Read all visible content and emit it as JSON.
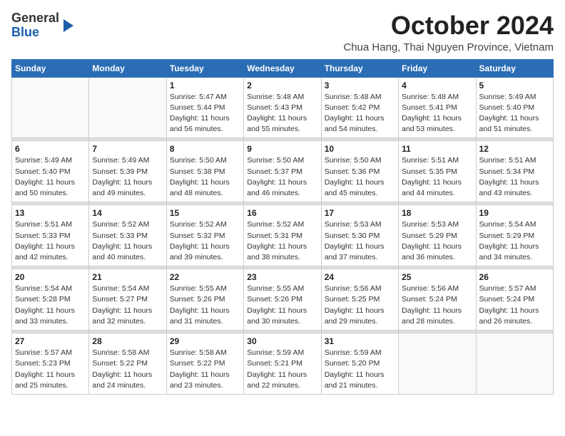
{
  "header": {
    "logo_general": "General",
    "logo_blue": "Blue",
    "month_title": "October 2024",
    "location": "Chua Hang, Thai Nguyen Province, Vietnam"
  },
  "weekdays": [
    "Sunday",
    "Monday",
    "Tuesday",
    "Wednesday",
    "Thursday",
    "Friday",
    "Saturday"
  ],
  "weeks": [
    [
      {
        "day": "",
        "info": ""
      },
      {
        "day": "",
        "info": ""
      },
      {
        "day": "1",
        "info": "Sunrise: 5:47 AM\nSunset: 5:44 PM\nDaylight: 11 hours and 56 minutes."
      },
      {
        "day": "2",
        "info": "Sunrise: 5:48 AM\nSunset: 5:43 PM\nDaylight: 11 hours and 55 minutes."
      },
      {
        "day": "3",
        "info": "Sunrise: 5:48 AM\nSunset: 5:42 PM\nDaylight: 11 hours and 54 minutes."
      },
      {
        "day": "4",
        "info": "Sunrise: 5:48 AM\nSunset: 5:41 PM\nDaylight: 11 hours and 53 minutes."
      },
      {
        "day": "5",
        "info": "Sunrise: 5:49 AM\nSunset: 5:40 PM\nDaylight: 11 hours and 51 minutes."
      }
    ],
    [
      {
        "day": "6",
        "info": "Sunrise: 5:49 AM\nSunset: 5:40 PM\nDaylight: 11 hours and 50 minutes."
      },
      {
        "day": "7",
        "info": "Sunrise: 5:49 AM\nSunset: 5:39 PM\nDaylight: 11 hours and 49 minutes."
      },
      {
        "day": "8",
        "info": "Sunrise: 5:50 AM\nSunset: 5:38 PM\nDaylight: 11 hours and 48 minutes."
      },
      {
        "day": "9",
        "info": "Sunrise: 5:50 AM\nSunset: 5:37 PM\nDaylight: 11 hours and 46 minutes."
      },
      {
        "day": "10",
        "info": "Sunrise: 5:50 AM\nSunset: 5:36 PM\nDaylight: 11 hours and 45 minutes."
      },
      {
        "day": "11",
        "info": "Sunrise: 5:51 AM\nSunset: 5:35 PM\nDaylight: 11 hours and 44 minutes."
      },
      {
        "day": "12",
        "info": "Sunrise: 5:51 AM\nSunset: 5:34 PM\nDaylight: 11 hours and 43 minutes."
      }
    ],
    [
      {
        "day": "13",
        "info": "Sunrise: 5:51 AM\nSunset: 5:33 PM\nDaylight: 11 hours and 42 minutes."
      },
      {
        "day": "14",
        "info": "Sunrise: 5:52 AM\nSunset: 5:33 PM\nDaylight: 11 hours and 40 minutes."
      },
      {
        "day": "15",
        "info": "Sunrise: 5:52 AM\nSunset: 5:32 PM\nDaylight: 11 hours and 39 minutes."
      },
      {
        "day": "16",
        "info": "Sunrise: 5:52 AM\nSunset: 5:31 PM\nDaylight: 11 hours and 38 minutes."
      },
      {
        "day": "17",
        "info": "Sunrise: 5:53 AM\nSunset: 5:30 PM\nDaylight: 11 hours and 37 minutes."
      },
      {
        "day": "18",
        "info": "Sunrise: 5:53 AM\nSunset: 5:29 PM\nDaylight: 11 hours and 36 minutes."
      },
      {
        "day": "19",
        "info": "Sunrise: 5:54 AM\nSunset: 5:29 PM\nDaylight: 11 hours and 34 minutes."
      }
    ],
    [
      {
        "day": "20",
        "info": "Sunrise: 5:54 AM\nSunset: 5:28 PM\nDaylight: 11 hours and 33 minutes."
      },
      {
        "day": "21",
        "info": "Sunrise: 5:54 AM\nSunset: 5:27 PM\nDaylight: 11 hours and 32 minutes."
      },
      {
        "day": "22",
        "info": "Sunrise: 5:55 AM\nSunset: 5:26 PM\nDaylight: 11 hours and 31 minutes."
      },
      {
        "day": "23",
        "info": "Sunrise: 5:55 AM\nSunset: 5:26 PM\nDaylight: 11 hours and 30 minutes."
      },
      {
        "day": "24",
        "info": "Sunrise: 5:56 AM\nSunset: 5:25 PM\nDaylight: 11 hours and 29 minutes."
      },
      {
        "day": "25",
        "info": "Sunrise: 5:56 AM\nSunset: 5:24 PM\nDaylight: 11 hours and 28 minutes."
      },
      {
        "day": "26",
        "info": "Sunrise: 5:57 AM\nSunset: 5:24 PM\nDaylight: 11 hours and 26 minutes."
      }
    ],
    [
      {
        "day": "27",
        "info": "Sunrise: 5:57 AM\nSunset: 5:23 PM\nDaylight: 11 hours and 25 minutes."
      },
      {
        "day": "28",
        "info": "Sunrise: 5:58 AM\nSunset: 5:22 PM\nDaylight: 11 hours and 24 minutes."
      },
      {
        "day": "29",
        "info": "Sunrise: 5:58 AM\nSunset: 5:22 PM\nDaylight: 11 hours and 23 minutes."
      },
      {
        "day": "30",
        "info": "Sunrise: 5:59 AM\nSunset: 5:21 PM\nDaylight: 11 hours and 22 minutes."
      },
      {
        "day": "31",
        "info": "Sunrise: 5:59 AM\nSunset: 5:20 PM\nDaylight: 11 hours and 21 minutes."
      },
      {
        "day": "",
        "info": ""
      },
      {
        "day": "",
        "info": ""
      }
    ]
  ]
}
